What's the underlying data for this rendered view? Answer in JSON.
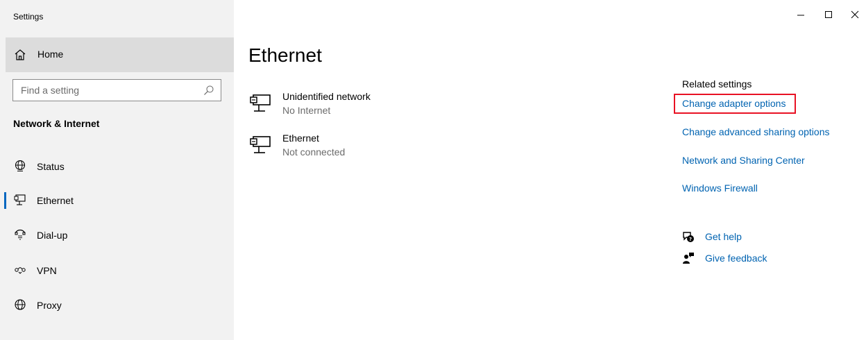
{
  "app": {
    "title": "Settings"
  },
  "window_controls": {
    "minimize_icon": "minimize-icon",
    "maximize_icon": "maximize-icon",
    "close_icon": "close-icon"
  },
  "sidebar": {
    "home_label": "Home",
    "search_placeholder": "Find a setting",
    "section_title": "Network & Internet",
    "items": [
      {
        "label": "Status",
        "icon": "status-globe-icon",
        "selected": false
      },
      {
        "label": "Ethernet",
        "icon": "ethernet-icon",
        "selected": true
      },
      {
        "label": "Dial-up",
        "icon": "dial-up-icon",
        "selected": false
      },
      {
        "label": "VPN",
        "icon": "vpn-icon",
        "selected": false
      },
      {
        "label": "Proxy",
        "icon": "proxy-globe-icon",
        "selected": false
      }
    ]
  },
  "main": {
    "title": "Ethernet",
    "networks": [
      {
        "name": "Unidentified network",
        "status": "No Internet"
      },
      {
        "name": "Ethernet",
        "status": "Not connected"
      }
    ]
  },
  "related": {
    "heading": "Related settings",
    "links": [
      {
        "label": "Change adapter options",
        "highlighted": true
      },
      {
        "label": "Change advanced sharing options"
      },
      {
        "label": "Network and Sharing Center"
      },
      {
        "label": "Windows Firewall"
      }
    ],
    "help": [
      {
        "label": "Get help",
        "icon": "get-help-icon"
      },
      {
        "label": "Give feedback",
        "icon": "give-feedback-icon"
      }
    ]
  },
  "colors": {
    "accent": "#0063b1",
    "sidebar_bg": "#f2f2f2",
    "selected_home_bg": "#dcdcdc",
    "highlight": "#e81123",
    "selection_bar": "#0067c0"
  }
}
